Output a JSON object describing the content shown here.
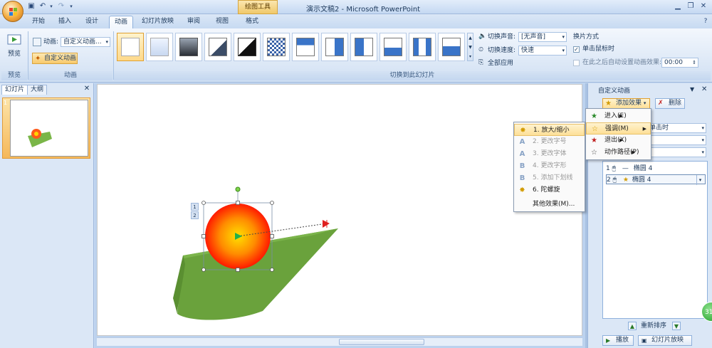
{
  "window": {
    "title": "演示文稿2 - Microsoft PowerPoint",
    "context_tool": "绘图工具"
  },
  "tabs": [
    {
      "label": "开始"
    },
    {
      "label": "插入"
    },
    {
      "label": "设计"
    },
    {
      "label": "动画",
      "active": true
    },
    {
      "label": "幻灯片放映"
    },
    {
      "label": "审阅"
    },
    {
      "label": "视图"
    },
    {
      "label": "格式"
    }
  ],
  "ribbon": {
    "preview": {
      "label": "预览",
      "group": "预览"
    },
    "animation": {
      "anim_label": "动画:",
      "anim_value": "自定义动画...",
      "custom_button": "自定义动画",
      "group": "动画"
    },
    "transition": {
      "group": "切换到此幻灯片",
      "sound_label": "切换声音:",
      "sound_value": "[无声音]",
      "speed_label": "切换速度:",
      "speed_value": "快速",
      "apply_all": "全部应用"
    },
    "advance": {
      "title": "换片方式",
      "on_click": "单击鼠标时",
      "on_click_checked": true,
      "after_time": "在此之后自动设置动画效果:",
      "after_time_value": "00:00"
    }
  },
  "left_panel": {
    "tab_slides": "幻灯片",
    "tab_outline": "大纲",
    "slide_number": "1"
  },
  "slide": {
    "tags": [
      "1",
      "2"
    ]
  },
  "task_pane": {
    "title": "自定义动画",
    "add_effect": "添加效果",
    "remove": "删除",
    "start_value": "单击时",
    "reorder": "重新排序",
    "play": "播放",
    "slideshow": "幻灯片放映",
    "anim_items": [
      {
        "index": "1",
        "name": "椭圆 4"
      },
      {
        "index": "2",
        "name": "椭圆 4"
      }
    ]
  },
  "add_effect_menu": [
    {
      "label": "进入(E)",
      "icon": "star-green-icon"
    },
    {
      "label": "强调(M)",
      "icon": "star-yellow-icon",
      "highlighted": true
    },
    {
      "label": "退出(X)",
      "icon": "star-red-icon"
    },
    {
      "label": "动作路径(P)",
      "icon": "star-outline-icon"
    }
  ],
  "emphasis_menu": [
    {
      "label": "1. 放大/缩小",
      "enabled": true,
      "highlighted": true
    },
    {
      "label": "2. 更改字号",
      "enabled": false
    },
    {
      "label": "3. 更改字体",
      "enabled": false
    },
    {
      "label": "4. 更改字形",
      "enabled": false
    },
    {
      "label": "5. 添加下划线",
      "enabled": false
    },
    {
      "label": "6. 陀螺旋",
      "enabled": true
    },
    {
      "label": "其他效果(M)...",
      "enabled": true
    }
  ],
  "badge": "31",
  "colors": {
    "accent": "#f8c96c",
    "ribbon": "#dbe7f6",
    "ball_center": "#ffe000",
    "ball_edge": "#ff1a00",
    "ramp": "#7ab648"
  }
}
